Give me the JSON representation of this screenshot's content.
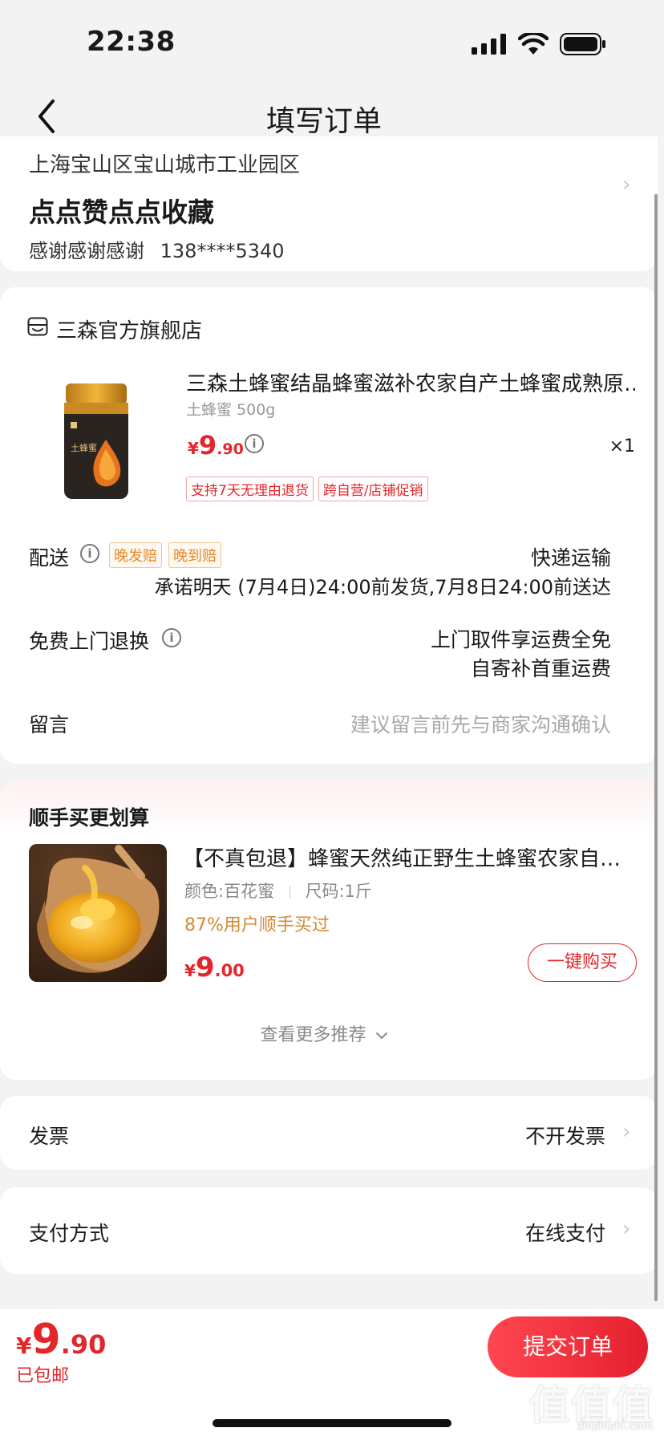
{
  "status_bar": {
    "time": "22:38"
  },
  "nav": {
    "title": "填写订单"
  },
  "address": {
    "line": "上海宝山区宝山城市工业园区",
    "name": "点点赞点点收藏",
    "contact": "感谢感谢感谢",
    "phone": "138****5340"
  },
  "shop": {
    "name": "三森官方旗舰店"
  },
  "product": {
    "title": "三森土蜂蜜结晶蜂蜜滋补农家自产土蜂蜜成熟原…",
    "spec": "土蜂蜜 500g",
    "label_text": "土蜂蜜",
    "currency": "¥",
    "price_int": "9",
    "price_dec": ".90",
    "qty": "×1",
    "tags": [
      "支持7天无理由退货",
      "跨自营/店铺促销"
    ]
  },
  "delivery": {
    "label": "配送",
    "tags": [
      "晚发赔",
      "晚到赔"
    ],
    "method": "快递运输",
    "promise": "承诺明天 (7月4日)24:00前发货,7月8日24:00前送达"
  },
  "returns": {
    "label": "免费上门退换",
    "line1": "上门取件享运费全免",
    "line2": "自寄补首重运费"
  },
  "message": {
    "label": "留言",
    "placeholder": "建议留言前先与商家沟通确认"
  },
  "recommend": {
    "title": "顺手买更划算",
    "name": "【不真包退】蜂蜜天然纯正野生土蜂蜜农家自…",
    "color": "颜色:百花蜜",
    "size": "尺码:1斤",
    "pct": "87%用户顺手买过",
    "currency": "¥",
    "price_int": "9",
    "price_dec": ".00",
    "buy_label": "一键购买",
    "more_label": "查看更多推荐"
  },
  "invoice": {
    "label": "发票",
    "value": "不开发票"
  },
  "payment": {
    "label": "支付方式",
    "value": "在线支付"
  },
  "footer": {
    "currency": "¥",
    "price_int": "9",
    "price_dec": ".90",
    "shipping": "已包邮",
    "submit_label": "提交订单"
  },
  "watermark": {
    "main": "值值值",
    "sub": "zhizhizhi.com"
  },
  "colors": {
    "accent": "#e3262b",
    "orange": "#e6872a",
    "background": "#f3f3f3"
  }
}
